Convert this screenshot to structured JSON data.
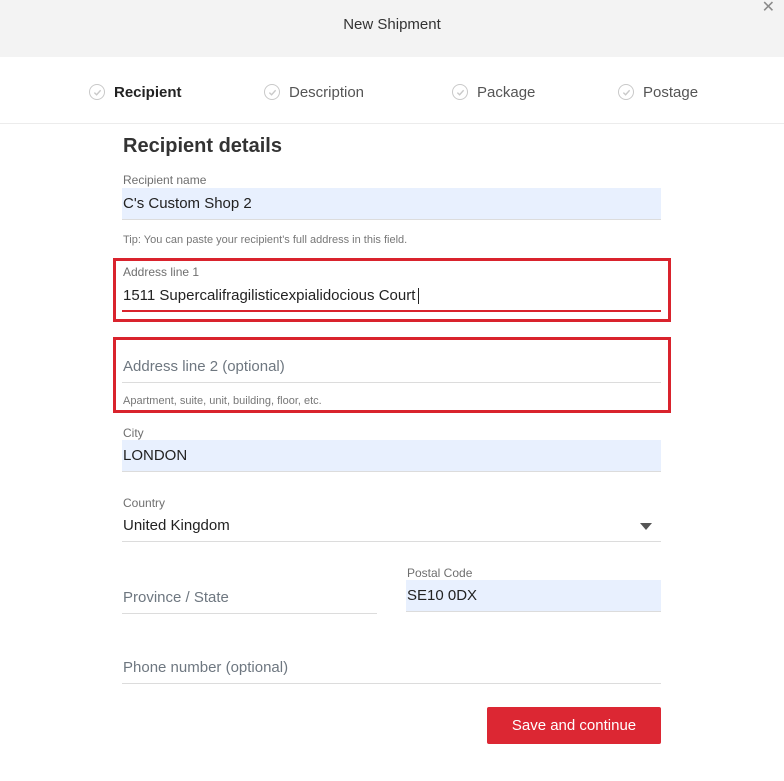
{
  "header": {
    "title": "New Shipment",
    "close_icon": "close-icon"
  },
  "steps": [
    {
      "label": "Recipient",
      "active": true
    },
    {
      "label": "Description",
      "active": false
    },
    {
      "label": "Package",
      "active": false
    },
    {
      "label": "Postage",
      "active": false
    }
  ],
  "form": {
    "section_title": "Recipient details",
    "recipient_name": {
      "label": "Recipient name",
      "value": "C's Custom Shop 2",
      "tip": "Tip: You can paste your recipient's full address in this field."
    },
    "address1": {
      "label": "Address line 1",
      "value": "1511 Supercalifragilisticexpialidocious Court"
    },
    "address2": {
      "placeholder": "Address line 2 (optional)",
      "hint": "Apartment, suite, unit, building, floor, etc."
    },
    "city": {
      "label": "City",
      "value": "LONDON"
    },
    "country": {
      "label": "Country",
      "value": "United Kingdom"
    },
    "province": {
      "placeholder": "Province / State"
    },
    "postal": {
      "label": "Postal Code",
      "value": "SE10 0DX"
    },
    "phone": {
      "placeholder": "Phone number (optional)"
    },
    "save_label": "Save and continue"
  },
  "colors": {
    "accent": "#dc2733",
    "highlight": "#d9232d",
    "autofill": "#e8f0fe"
  }
}
